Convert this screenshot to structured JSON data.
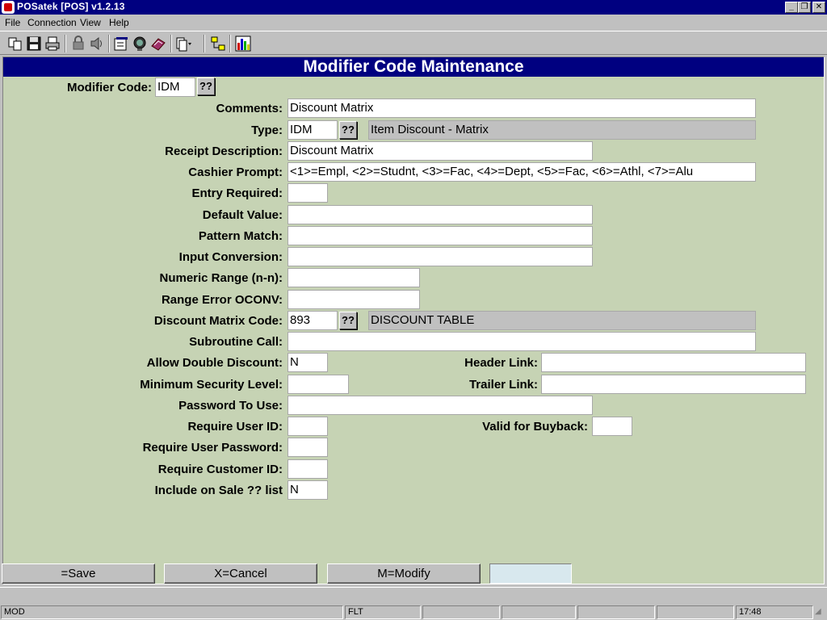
{
  "window": {
    "title": "POSatek [POS]  v1.2.13"
  },
  "menu": [
    "File",
    "Connection",
    "View",
    "Help"
  ],
  "toolbar_icons": [
    "copy-icon",
    "save-icon",
    "print-icon",
    "lock-icon",
    "audio-icon",
    "properties-icon",
    "monitor-icon",
    "book-icon",
    "document-dropdown-icon",
    "network-icon",
    "chart-icon"
  ],
  "form": {
    "title": "Modifier Code Maintenance",
    "modifier_code": {
      "label": "Modifier Code:",
      "value": "IDM",
      "lookup": "??"
    },
    "comments": {
      "label": "Comments:",
      "value": "Discount Matrix"
    },
    "type": {
      "label": "Type:",
      "value": "IDM",
      "lookup": "??",
      "description": "Item Discount - Matrix"
    },
    "receipt_description": {
      "label": "Receipt Description:",
      "value": "Discount Matrix"
    },
    "cashier_prompt": {
      "label": "Cashier Prompt:",
      "value": "<1>=Empl, <2>=Studnt, <3>=Fac, <4>=Dept, <5>=Fac, <6>=Athl, <7>=Alu"
    },
    "entry_required": {
      "label": "Entry Required:",
      "value": ""
    },
    "default_value": {
      "label": "Default Value:",
      "value": ""
    },
    "pattern_match": {
      "label": "Pattern Match:",
      "value": ""
    },
    "input_conversion": {
      "label": "Input Conversion:",
      "value": ""
    },
    "numeric_range": {
      "label": "Numeric Range (n-n):",
      "value": ""
    },
    "range_error": {
      "label": "Range Error OCONV:",
      "value": ""
    },
    "discount_matrix_code": {
      "label": "Discount Matrix Code:",
      "value": "893",
      "lookup": "??",
      "description": "DISCOUNT TABLE"
    },
    "subroutine_call": {
      "label": "Subroutine Call:",
      "value": ""
    },
    "allow_double_discount": {
      "label": "Allow Double Discount:",
      "value": "N"
    },
    "header_link": {
      "label": "Header Link:",
      "value": ""
    },
    "minimum_security_level": {
      "label": "Minimum Security Level:",
      "value": ""
    },
    "trailer_link": {
      "label": "Trailer Link:",
      "value": ""
    },
    "password_to_use": {
      "label": "Password To Use:",
      "value": ""
    },
    "require_user_id": {
      "label": "Require User ID:",
      "value": ""
    },
    "valid_for_buyback": {
      "label": "Valid for Buyback:",
      "value": ""
    },
    "require_user_password": {
      "label": "Require User Password:",
      "value": ""
    },
    "require_customer_id": {
      "label": "Require Customer ID:",
      "value": ""
    },
    "include_on_sale_list": {
      "label": "Include on Sale ?? list",
      "value": "N"
    }
  },
  "buttons": {
    "save": "=Save",
    "cancel": "X=Cancel",
    "modify": "M=Modify"
  },
  "status": {
    "mode": "MOD",
    "flt": "FLT",
    "time": "17:48"
  }
}
